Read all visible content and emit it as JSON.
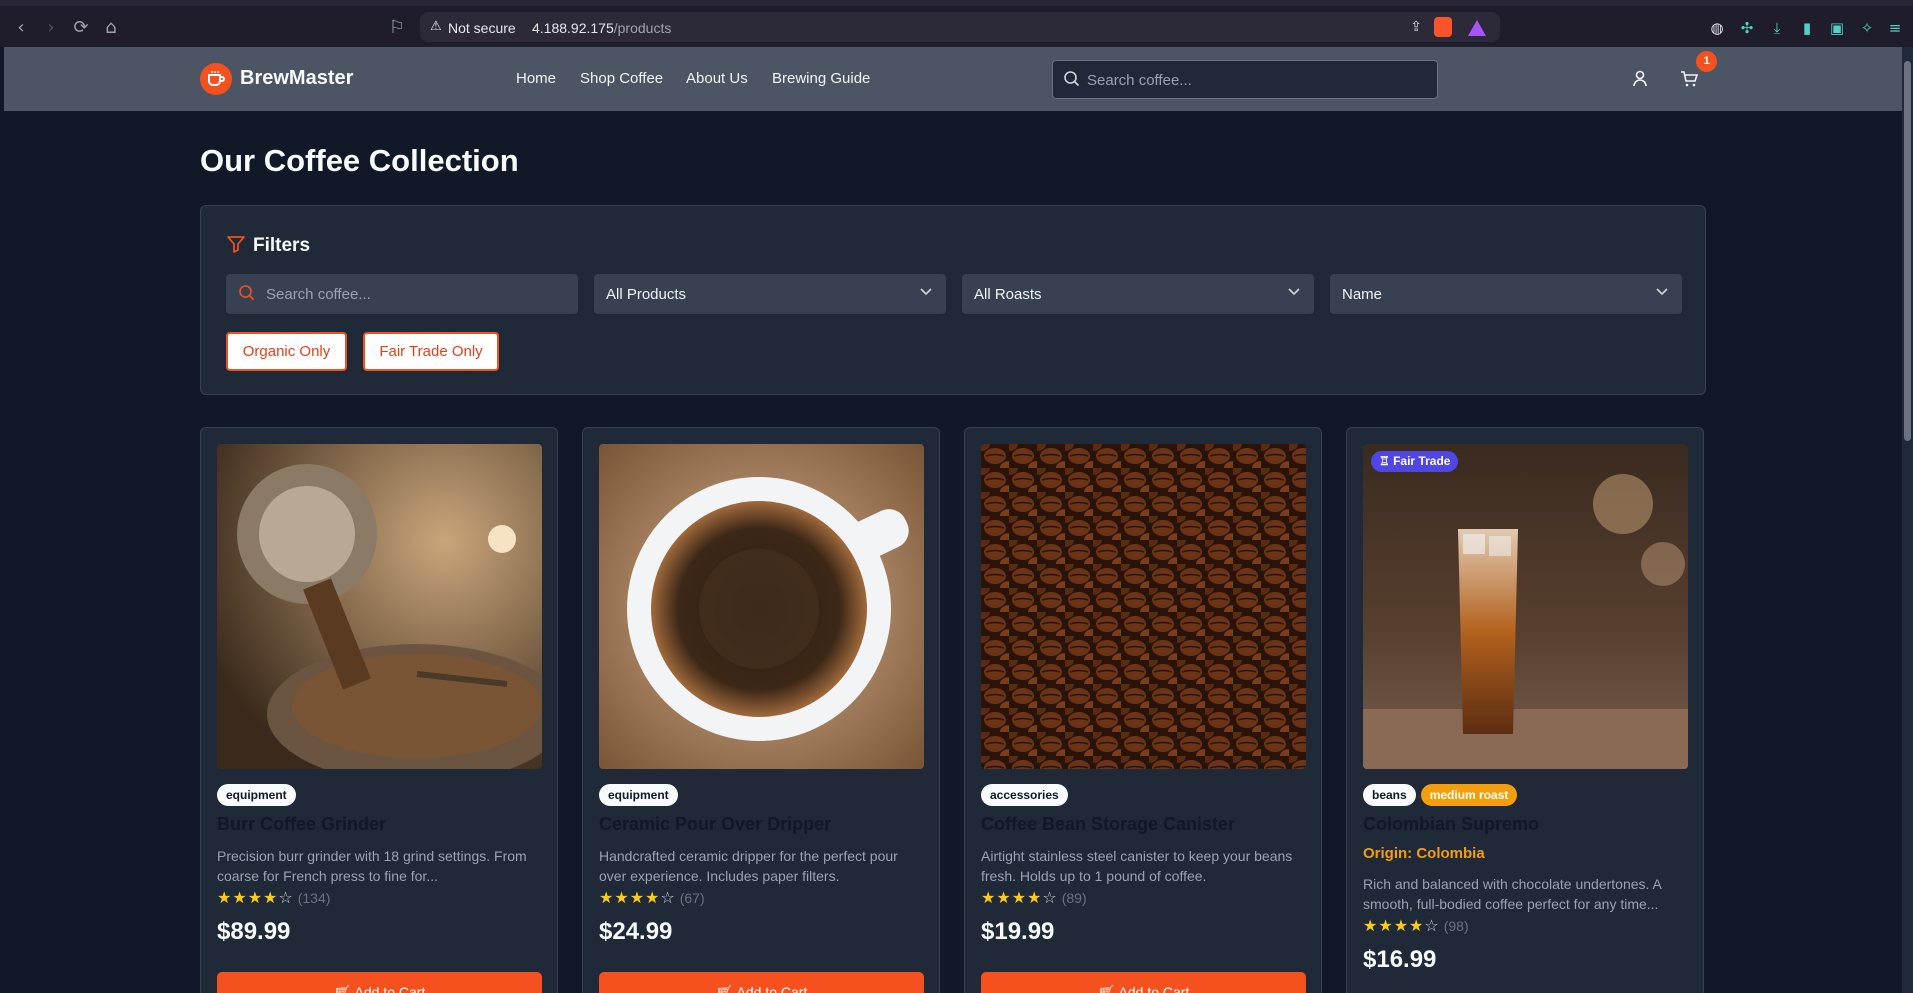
{
  "browser": {
    "security_label": "Not secure",
    "host": "4.188.92.175",
    "path": "/products"
  },
  "header": {
    "brand": "BrewMaster",
    "nav": [
      "Home",
      "Shop Coffee",
      "About Us",
      "Brewing Guide"
    ],
    "search_placeholder": "Search coffee...",
    "cart_count": "1"
  },
  "page_title": "Our Coffee Collection",
  "filters": {
    "title": "Filters",
    "search_placeholder": "Search coffee...",
    "category": "All Products",
    "roast": "All Roasts",
    "sort": "Name",
    "organic_label": "Organic Only",
    "fairtrade_label": "Fair Trade Only"
  },
  "products": [
    {
      "tags": [
        "equipment"
      ],
      "name": "Burr Coffee Grinder",
      "description": "Precision burr grinder with 18 grind settings. From coarse for French press to fine for...",
      "rating": 4,
      "reviews": "(134)",
      "price": "$89.99",
      "cta": "Add to Cart",
      "image": "coffee-roaster-photo"
    },
    {
      "tags": [
        "equipment"
      ],
      "name": "Ceramic Pour Over Dripper",
      "description": "Handcrafted ceramic dripper for the perfect pour over experience. Includes paper filters.",
      "rating": 4,
      "reviews": "(67)",
      "price": "$24.99",
      "cta": "Add to Cart",
      "image": "coffee-cup-photo"
    },
    {
      "tags": [
        "accessories"
      ],
      "name": "Coffee Bean Storage Canister",
      "description": "Airtight stainless steel canister to keep your beans fresh. Holds up to 1 pound of coffee.",
      "rating": 4,
      "reviews": "(89)",
      "price": "$19.99",
      "cta": "Add to Cart",
      "image": "coffee-beans-photo"
    },
    {
      "tags": [
        "beans",
        "medium roast"
      ],
      "badge": "Fair Trade",
      "name": "Colombian Supremo",
      "origin": "Origin: Colombia",
      "description": "Rich and balanced with chocolate undertones. A smooth, full-bodied coffee perfect for any time...",
      "rating": 4,
      "reviews": "(98)",
      "price": "$16.99",
      "image": "iced-coffee-photo"
    }
  ],
  "colors": {
    "accent": "#f4511e",
    "star": "#facc15",
    "badge_fairtrade": "#4f46e5",
    "tag_roast": "#f59e0b"
  }
}
